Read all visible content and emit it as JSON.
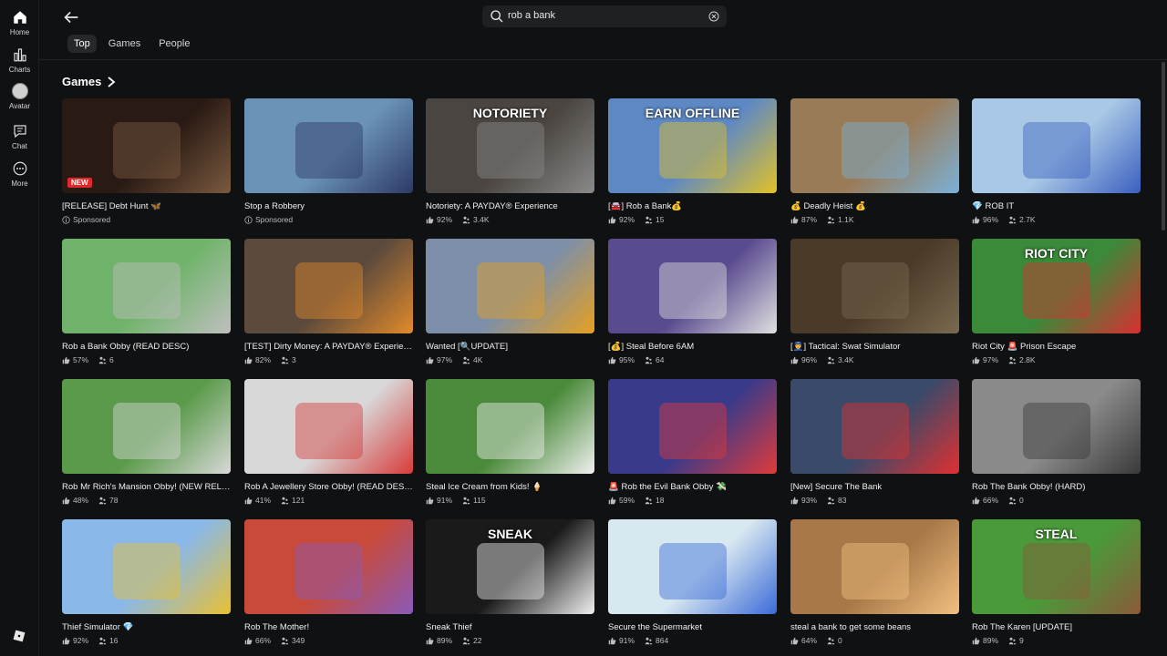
{
  "sidebar": {
    "items": [
      {
        "label": "Home",
        "icon": "home-icon"
      },
      {
        "label": "Charts",
        "icon": "charts-icon"
      },
      {
        "label": "Avatar",
        "icon": "avatar-icon"
      },
      {
        "label": "Chat",
        "icon": "chat-icon"
      },
      {
        "label": "More",
        "icon": "more-icon"
      }
    ]
  },
  "search": {
    "value": "rob a bank"
  },
  "tabs": [
    {
      "label": "Top",
      "active": true
    },
    {
      "label": "Games",
      "active": false
    },
    {
      "label": "People",
      "active": false
    }
  ],
  "section": {
    "title": "Games"
  },
  "games": [
    {
      "title": "[RELEASE] Debt Hunt 🦋",
      "meta_type": "sponsored",
      "sponsored": "Sponsored",
      "badge": "NEW",
      "bg": "#2a1a14",
      "accent": "#7a5a40"
    },
    {
      "title": "Stop a Robbery",
      "meta_type": "sponsored",
      "sponsored": "Sponsored",
      "bg": "#6b93b8",
      "accent": "#2d3a66"
    },
    {
      "title": "Notoriety: A PAYDAY® Experience",
      "rating": "92%",
      "players": "3.4K",
      "overlay": "NOTORIETY",
      "bg": "#4a4540",
      "accent": "#8a8a8a"
    },
    {
      "title": "[🚘] Rob a Bank💰",
      "rating": "92%",
      "players": "15",
      "overlay": "EARN OFFLINE",
      "bg": "#5d88c4",
      "accent": "#e2c227"
    },
    {
      "title": "💰 Deadly Heist 💰",
      "rating": "87%",
      "players": "1.1K",
      "bg": "#9a7b58",
      "accent": "#7bb1d8"
    },
    {
      "title": "💎 ROB IT",
      "rating": "96%",
      "players": "2.7K",
      "bg": "#a9c8e6",
      "accent": "#3a5fbf"
    },
    {
      "title": "Rob a Bank Obby (READ DESC)",
      "rating": "57%",
      "players": "6",
      "bg": "#6fb36a",
      "accent": "#bfbfbf"
    },
    {
      "title": "[TEST] Dirty Money: A PAYDAY® Experience",
      "rating": "82%",
      "players": "3",
      "bg": "#5c4a3c",
      "accent": "#e28a2a"
    },
    {
      "title": "Wanted [🔍UPDATE]",
      "rating": "97%",
      "players": "4K",
      "bg": "#7d8fa8",
      "accent": "#e6a020"
    },
    {
      "title": "[💰] Steal Before 6AM",
      "rating": "95%",
      "players": "64",
      "bg": "#5a4a8f",
      "accent": "#e0e0e0"
    },
    {
      "title": "[👮] Tactical: Swat Simulator",
      "rating": "96%",
      "players": "3.4K",
      "bg": "#4a3a28",
      "accent": "#7a6a50"
    },
    {
      "title": "Riot City 🚨 Prison Escape",
      "rating": "97%",
      "players": "2.8K",
      "overlay": "RIOT CITY",
      "bg": "#3a8a3a",
      "accent": "#d83030"
    },
    {
      "title": "Rob Mr Rich's Mansion Obby! (NEW RELEASE)",
      "rating": "48%",
      "players": "78",
      "bg": "#5a9a4a",
      "accent": "#d8d8d8"
    },
    {
      "title": "Rob A Jewellery Store Obby! (READ DESC)",
      "rating": "41%",
      "players": "121",
      "bg": "#d8d8d8",
      "accent": "#d83a3a"
    },
    {
      "title": "Steal Ice Cream from Kids! 🍦",
      "rating": "91%",
      "players": "115",
      "bg": "#4a8a3a",
      "accent": "#f0f0f0"
    },
    {
      "title": "🚨 Rob the Evil Bank Obby 💸",
      "rating": "59%",
      "players": "18",
      "bg": "#3a3a8a",
      "accent": "#e03a3a"
    },
    {
      "title": "[New] Secure The Bank",
      "rating": "93%",
      "players": "83",
      "bg": "#3a4a6a",
      "accent": "#e03030"
    },
    {
      "title": "Rob The Bank Obby! (HARD)",
      "rating": "66%",
      "players": "0",
      "bg": "#8a8a8a",
      "accent": "#3a3a3a"
    },
    {
      "title": "Thief Simulator 💎",
      "rating": "92%",
      "players": "16",
      "bg": "#8ab8e8",
      "accent": "#e8c030"
    },
    {
      "title": "Rob The Mother!",
      "rating": "66%",
      "players": "349",
      "bg": "#c84a3a",
      "accent": "#8a5ab8"
    },
    {
      "title": "Sneak Thief",
      "rating": "89%",
      "players": "22",
      "overlay": "SNEAK",
      "bg": "#1a1a1a",
      "accent": "#f0f0f0"
    },
    {
      "title": "Secure the Supermarket",
      "rating": "91%",
      "players": "864",
      "bg": "#d8e8f0",
      "accent": "#3a6ad8"
    },
    {
      "title": "steal a bank to get some beans",
      "rating": "64%",
      "players": "0",
      "bg": "#a87848",
      "accent": "#f0c080"
    },
    {
      "title": "Rob The Karen [UPDATE]",
      "rating": "89%",
      "players": "9",
      "overlay": "STEAL",
      "bg": "#4a9a3a",
      "accent": "#8a5a3a"
    }
  ]
}
